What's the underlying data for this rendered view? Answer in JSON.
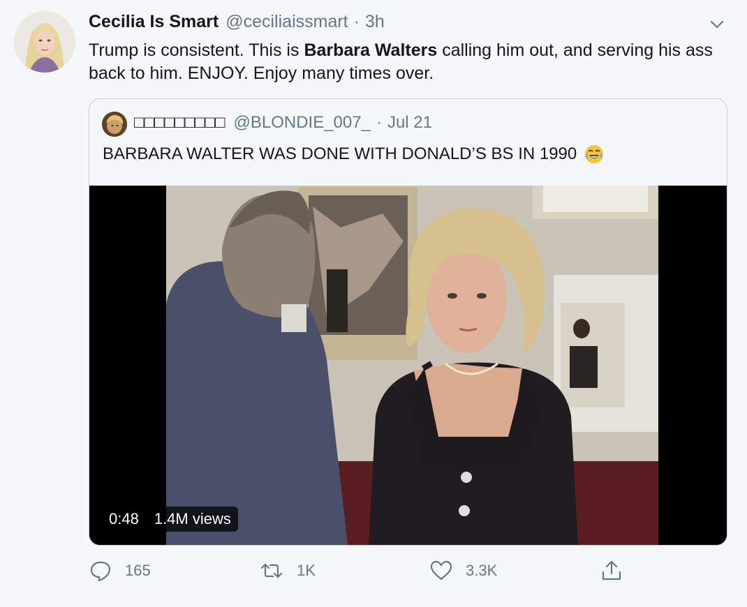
{
  "tweet": {
    "display_name": "Cecilia Is Smart",
    "handle": "@ceciliaissmart",
    "separator": "·",
    "time": "3h",
    "text_before": "Trump is consistent. This is ",
    "text_bold": "Barbara Walters",
    "text_after": " calling him out, and serving his ass back to him. ENJOY. Enjoy many times over."
  },
  "quote": {
    "display_name": "□□□□□□□□□",
    "handle": "@BLONDIE_007_",
    "separator": "·",
    "time": "Jul 21",
    "text": "BARBARA WALTER WAS DONE WITH DONALD’S BS IN 1990",
    "emoji": "face-with-tears-of-joy",
    "video": {
      "duration": "0:48",
      "views": "1.4M views"
    }
  },
  "actions": {
    "reply_count": "165",
    "retweet_count": "1K",
    "like_count": "3.3K"
  },
  "colors": {
    "background": "#f5f8fa",
    "text": "#14171a",
    "secondary": "#657786",
    "border": "#c4cfd6"
  },
  "icons": [
    "reply-icon",
    "retweet-icon",
    "like-icon",
    "share-icon",
    "chevron-down-icon"
  ]
}
